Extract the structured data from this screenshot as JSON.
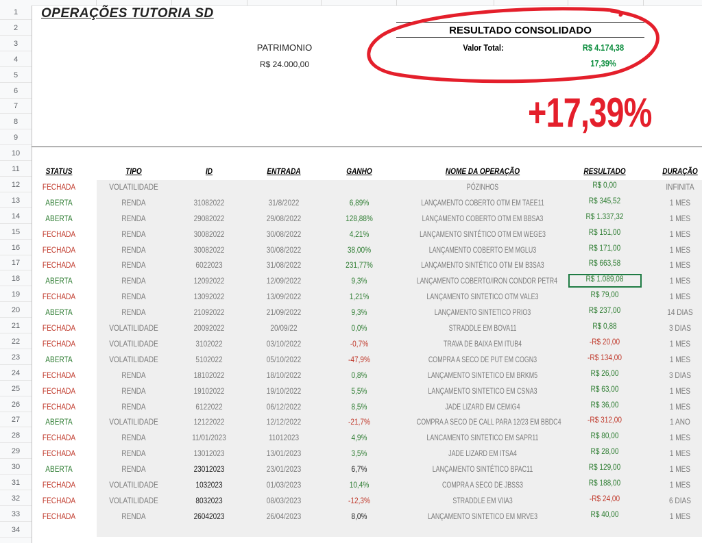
{
  "sheet": {
    "title": "OPERAÇÕES TUTORIA SD",
    "row_numbers": [
      "1",
      "2",
      "3",
      "4",
      "5",
      "6",
      "7",
      "8",
      "9",
      "10",
      "11",
      "12",
      "13",
      "14",
      "15",
      "16",
      "17",
      "18",
      "19",
      "20",
      "21",
      "22",
      "23",
      "24",
      "25",
      "26",
      "27",
      "28",
      "29",
      "30",
      "31",
      "32",
      "33",
      "34"
    ],
    "patrimonio_label": "PATRIMONIO",
    "patrimonio_value": "R$ 24.000,00",
    "result_title": "RESULTADO CONSOLIDADO",
    "valor_total_label": "Valor Total:",
    "valor_total_value": "R$ 4.174,38",
    "percent_value": "17,39%",
    "big_percent": "+17,39%",
    "accent_colors": {
      "green": "#2e7d32",
      "red": "#c0392b",
      "big_red": "#e41f2b",
      "circle": "#e41f2b"
    }
  },
  "headers": [
    "STATUS",
    "TIPO",
    "ID",
    "ENTRADA",
    "GANHO",
    "NOME DA OPERAÇÃO",
    "RESULTADO",
    "DURAÇÃO"
  ],
  "rows": [
    {
      "status": "FECHADA",
      "tipo": "VOLATILIDADE",
      "id": "",
      "entrada": "",
      "ganho": "",
      "nome": "PÓZINHOS",
      "resultado": "R$ 0,00",
      "duracao": "INFINITA"
    },
    {
      "status": "ABERTA",
      "tipo": "RENDA",
      "id": "31082022",
      "entrada": "31/8/2022",
      "ganho": "6,89%",
      "nome": "LANÇAMENTO COBERTO OTM EM TAEE11",
      "resultado": "R$ 345,52",
      "duracao": "1 MES"
    },
    {
      "status": "ABERTA",
      "tipo": "RENDA",
      "id": "29082022",
      "entrada": "29/08/2022",
      "ganho": "128,88%",
      "nome": "LANÇAMENTO COBERTO OTM EM BBSA3",
      "resultado": "R$ 1.337,32",
      "duracao": "1 MES"
    },
    {
      "status": "FECHADA",
      "tipo": "RENDA",
      "id": "30082022",
      "entrada": "30/08/2022",
      "ganho": "4,21%",
      "nome": "LANÇAMENTO SINTÉTICO OTM EM WEGE3",
      "resultado": "R$ 151,00",
      "duracao": "1 MES"
    },
    {
      "status": "FECHADA",
      "tipo": "RENDA",
      "id": "30082022",
      "entrada": "30/08/2022",
      "ganho": "38,00%",
      "nome": "LANÇAMENTO COBERTO EM MGLU3",
      "resultado": "R$ 171,00",
      "duracao": "1 MES"
    },
    {
      "status": "FECHADA",
      "tipo": "RENDA",
      "id": "6022023",
      "entrada": "31/08/2022",
      "ganho": "231,77%",
      "nome": "LANÇAMENTO SINTÉTICO OTM EM B3SA3",
      "resultado": "R$ 663,58",
      "duracao": "1 MES"
    },
    {
      "status": "ABERTA",
      "tipo": "RENDA",
      "id": "12092022",
      "entrada": "12/09/2022",
      "ganho": "9,3%",
      "nome": "LANÇAMENTO COBERTO/IRON CONDOR PETR4",
      "resultado": "R$ 1.089,08",
      "duracao": "1 MES"
    },
    {
      "status": "FECHADA",
      "tipo": "RENDA",
      "id": "13092022",
      "entrada": "13/09/2022",
      "ganho": "1,21%",
      "nome": "LANÇAMENTO SINTETICO OTM VALE3",
      "resultado": "R$ 79,00",
      "duracao": "1 MES"
    },
    {
      "status": "ABERTA",
      "tipo": "RENDA",
      "id": "21092022",
      "entrada": "21/09/2022",
      "ganho": "9,3%",
      "nome": "LANÇAMENTO SINTETICO PRIO3",
      "resultado": "R$ 237,00",
      "duracao": "14 DIAS"
    },
    {
      "status": "FECHADA",
      "tipo": "VOLATILIDADE",
      "id": "20092022",
      "entrada": "20/09/22",
      "ganho": "0,0%",
      "nome": "STRADDLE EM BOVA11",
      "resultado": "R$ 0,88",
      "duracao": "3 DIAS"
    },
    {
      "status": "FECHADA",
      "tipo": "VOLATILIDADE",
      "id": "3102022",
      "entrada": "03/10/2022",
      "ganho": "-0,7%",
      "nome": "TRAVA DE BAIXA EM ITUB4",
      "resultado": "-R$ 20,00",
      "duracao": "1 MES"
    },
    {
      "status": "ABERTA",
      "tipo": "VOLATILIDADE",
      "id": "5102022",
      "entrada": "05/10/2022",
      "ganho": "-47,9%",
      "nome": "COMPRA A SECO DE PUT EM COGN3",
      "resultado": "-R$ 134,00",
      "duracao": "1 MES"
    },
    {
      "status": "FECHADA",
      "tipo": "RENDA",
      "id": "18102022",
      "entrada": "18/10/2022",
      "ganho": "0,8%",
      "nome": "LANÇAMENTO SINTETICO EM BRKM5",
      "resultado": "R$ 26,00",
      "duracao": "3 DIAS"
    },
    {
      "status": "FECHADA",
      "tipo": "RENDA",
      "id": "19102022",
      "entrada": "19/10/2022",
      "ganho": "5,5%",
      "nome": "LANÇAMENTO SINTETICO EM CSNA3",
      "resultado": "R$ 63,00",
      "duracao": "1 MES"
    },
    {
      "status": "FECHADA",
      "tipo": "RENDA",
      "id": "6122022",
      "entrada": "06/12/2022",
      "ganho": "8,5%",
      "nome": "JADE LIZARD EM CEMIG4",
      "resultado": "R$ 36,00",
      "duracao": "1 MES"
    },
    {
      "status": "ABERTA",
      "tipo": "VOLATILIDADE",
      "id": "12122022",
      "entrada": "12/12/2022",
      "ganho": "-21,7%",
      "nome": "COMPRA A SECO DE CALL PARA 12/23 EM BBDC4",
      "resultado": "-R$ 312,00",
      "duracao": "1 ANO"
    },
    {
      "status": "FECHADA",
      "tipo": "RENDA",
      "id": "11/01/2023",
      "entrada": "11012023",
      "ganho": "4,9%",
      "nome": "LANCAMENTO SINTETICO EM SAPR11",
      "resultado": "R$ 80,00",
      "duracao": "1 MES"
    },
    {
      "status": "FECHADA",
      "tipo": "RENDA",
      "id": "13012023",
      "entrada": "13/01/2023",
      "ganho": "3,5%",
      "nome": "JADE LIZARD EM ITSA4",
      "resultado": "R$ 28,00",
      "duracao": "1 MES"
    },
    {
      "status": "ABERTA",
      "tipo": "RENDA",
      "id": "23012023",
      "entrada": "23/01/2023",
      "ganho": "6,7%",
      "nome": "LANÇAMENTO SINTÉTICO BPAC11",
      "resultado": "R$ 129,00",
      "duracao": "1 MES"
    },
    {
      "status": "FECHADA",
      "tipo": "VOLATILIDADE",
      "id": "1032023",
      "entrada": "01/03/2023",
      "ganho": "10,4%",
      "nome": "COMPRA A SECO DE JBSS3",
      "resultado": "R$ 188,00",
      "duracao": "1 MES"
    },
    {
      "status": "FECHADA",
      "tipo": "VOLATILIDADE",
      "id": "8032023",
      "entrada": "08/03/2023",
      "ganho": "-12,3%",
      "nome": "STRADDLE EM VIIA3",
      "resultado": "-R$ 24,00",
      "duracao": "6 DIAS"
    },
    {
      "status": "FECHADA",
      "tipo": "RENDA",
      "id": "26042023",
      "entrada": "26/04/2023",
      "ganho": "8,0%",
      "nome": "LANÇAMENTO SINTETICO EM MRVE3",
      "resultado": "R$ 40,00",
      "duracao": "1 MES"
    }
  ]
}
